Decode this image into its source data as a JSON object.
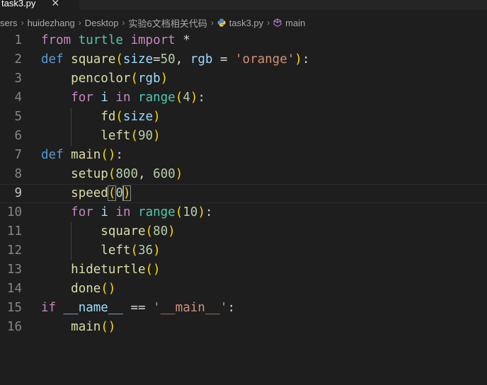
{
  "tab": {
    "label": "task3.py",
    "close_glyph": "✕"
  },
  "breadcrumb": {
    "items": [
      "sers",
      "huidezhang",
      "Desktop",
      "实验6文档相关代码",
      "task3.py",
      "main"
    ],
    "separator": "›"
  },
  "editor": {
    "current_line": 9,
    "line_numbers": [
      "1",
      "2",
      "3",
      "4",
      "5",
      "6",
      "7",
      "8",
      "9",
      "10",
      "11",
      "12",
      "13",
      "14",
      "15",
      "16"
    ],
    "lines": [
      [
        [
          "kw-ctrl",
          "from"
        ],
        [
          "plain",
          " "
        ],
        [
          "mod",
          "turtle"
        ],
        [
          "plain",
          " "
        ],
        [
          "kw-ctrl",
          "import"
        ],
        [
          "plain",
          " *"
        ]
      ],
      [
        [
          "kw",
          "def"
        ],
        [
          "plain",
          " "
        ],
        [
          "fn",
          "square"
        ],
        [
          "br1",
          "("
        ],
        [
          "var",
          "size"
        ],
        [
          "plain",
          "="
        ],
        [
          "num",
          "50"
        ],
        [
          "plain",
          ", "
        ],
        [
          "var",
          "rgb"
        ],
        [
          "plain",
          " = "
        ],
        [
          "str",
          "'orange'"
        ],
        [
          "br1",
          ")"
        ],
        [
          "plain",
          ":"
        ]
      ],
      [
        [
          "plain",
          "    "
        ],
        [
          "fn",
          "pencolor"
        ],
        [
          "br1",
          "("
        ],
        [
          "var",
          "rgb"
        ],
        [
          "br1",
          ")"
        ]
      ],
      [
        [
          "plain",
          "    "
        ],
        [
          "kw-ctrl",
          "for"
        ],
        [
          "plain",
          " "
        ],
        [
          "var",
          "i"
        ],
        [
          "plain",
          " "
        ],
        [
          "kw-ctrl",
          "in"
        ],
        [
          "plain",
          " "
        ],
        [
          "mod",
          "range"
        ],
        [
          "br1",
          "("
        ],
        [
          "num",
          "4"
        ],
        [
          "br1",
          ")"
        ],
        [
          "plain",
          ":"
        ]
      ],
      [
        [
          "plain",
          "        "
        ],
        [
          "fn",
          "fd"
        ],
        [
          "br1",
          "("
        ],
        [
          "var",
          "size"
        ],
        [
          "br1",
          ")"
        ]
      ],
      [
        [
          "plain",
          "        "
        ],
        [
          "fn",
          "left"
        ],
        [
          "br1",
          "("
        ],
        [
          "num",
          "90"
        ],
        [
          "br1",
          ")"
        ]
      ],
      [
        [
          "kw",
          "def"
        ],
        [
          "plain",
          " "
        ],
        [
          "fn",
          "main"
        ],
        [
          "br1",
          "()"
        ],
        [
          "plain",
          ":"
        ]
      ],
      [
        [
          "plain",
          "    "
        ],
        [
          "fn",
          "setup"
        ],
        [
          "br1",
          "("
        ],
        [
          "num",
          "800"
        ],
        [
          "plain",
          ", "
        ],
        [
          "num",
          "600"
        ],
        [
          "br1",
          ")"
        ]
      ],
      [
        [
          "plain",
          "    "
        ],
        [
          "fn",
          "speed"
        ],
        [
          "br1m",
          "("
        ],
        [
          "num",
          "0"
        ],
        [
          "br1m",
          ")"
        ]
      ],
      [
        [
          "plain",
          "    "
        ],
        [
          "kw-ctrl",
          "for"
        ],
        [
          "plain",
          " "
        ],
        [
          "var",
          "i"
        ],
        [
          "plain",
          " "
        ],
        [
          "kw-ctrl",
          "in"
        ],
        [
          "plain",
          " "
        ],
        [
          "mod",
          "range"
        ],
        [
          "br1",
          "("
        ],
        [
          "num",
          "10"
        ],
        [
          "br1",
          ")"
        ],
        [
          "plain",
          ":"
        ]
      ],
      [
        [
          "plain",
          "        "
        ],
        [
          "fn",
          "square"
        ],
        [
          "br1",
          "("
        ],
        [
          "num",
          "80"
        ],
        [
          "br1",
          ")"
        ]
      ],
      [
        [
          "plain",
          "        "
        ],
        [
          "fn",
          "left"
        ],
        [
          "br1",
          "("
        ],
        [
          "num",
          "36"
        ],
        [
          "br1",
          ")"
        ]
      ],
      [
        [
          "plain",
          "    "
        ],
        [
          "fn",
          "hideturtle"
        ],
        [
          "br1",
          "()"
        ]
      ],
      [
        [
          "plain",
          "    "
        ],
        [
          "fn",
          "done"
        ],
        [
          "br1",
          "()"
        ]
      ],
      [
        [
          "kw-ctrl",
          "if"
        ],
        [
          "plain",
          " "
        ],
        [
          "var",
          "__name__"
        ],
        [
          "plain",
          " == "
        ],
        [
          "str",
          "'__main__'"
        ],
        [
          "plain",
          ":"
        ]
      ],
      [
        [
          "plain",
          "    "
        ],
        [
          "fn",
          "main"
        ],
        [
          "br1",
          "()"
        ]
      ]
    ],
    "indent_levels": [
      0,
      0,
      1,
      1,
      2,
      2,
      0,
      1,
      1,
      1,
      2,
      2,
      1,
      1,
      0,
      1
    ]
  },
  "icons": {
    "file_icon": "python-icon",
    "symbol_icon": "method-symbol-icon"
  }
}
